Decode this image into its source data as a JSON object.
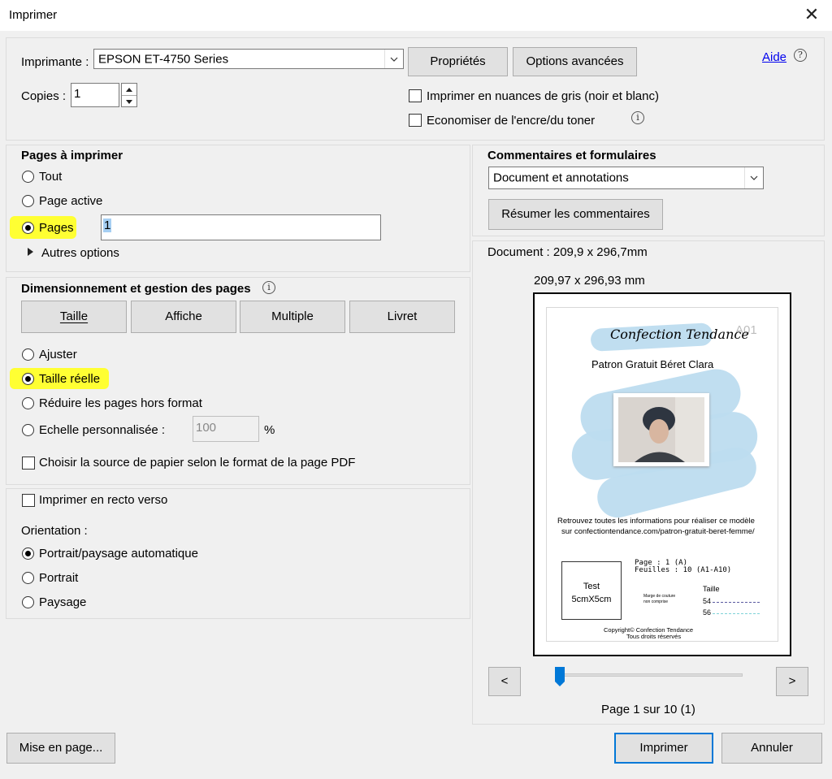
{
  "window": {
    "title": "Imprimer"
  },
  "printer": {
    "label": "Imprimante :",
    "selected": "EPSON ET-4750 Series",
    "properties_button": "Propriétés",
    "advanced_button": "Options avancées",
    "help_link": "Aide",
    "copies_label": "Copies :",
    "copies_value": "1",
    "grayscale_label": "Imprimer en nuances de gris (noir et blanc)",
    "grayscale_checked": false,
    "save_ink_label": "Economiser de l'encre/du toner",
    "save_ink_checked": false
  },
  "pages": {
    "title": "Pages à imprimer",
    "all": "Tout",
    "current": "Page active",
    "pages": "Pages",
    "pages_value": "1",
    "more_options": "Autres options",
    "selected": "pages"
  },
  "comments": {
    "title": "Commentaires et formulaires",
    "selected": "Document et annotations",
    "summarize_button": "Résumer les commentaires"
  },
  "sizing": {
    "title": "Dimensionnement et gestion des pages",
    "tabs": [
      "Taille",
      "Affiche",
      "Multiple",
      "Livret"
    ],
    "fit": "Ajuster",
    "actual": "Taille réelle",
    "shrink": "Réduire les pages hors format",
    "custom": "Echelle personnalisée :",
    "custom_value": "100",
    "percent": "%",
    "paper_source": "Choisir la source de papier selon le format de la page PDF",
    "selected": "actual"
  },
  "duplex": {
    "label": "Imprimer en recto verso",
    "orientation_label": "Orientation :",
    "auto": "Portrait/paysage automatique",
    "portrait": "Portrait",
    "landscape": "Paysage",
    "selected": "auto"
  },
  "preview": {
    "document_size": "Document : 209,9 x 296,7mm",
    "paper_size": "209,97 x 296,93 mm",
    "page_info": "Page 1 sur 10 (1)",
    "prev": "<",
    "next": ">",
    "slider_position": 0.0,
    "page": {
      "corner_label": "A01",
      "brand": "Confection Tendance",
      "subtitle": "Patron Gratuit Béret Clara",
      "info_line1": "Retrouvez toutes les informations pour réaliser ce modèle",
      "info_line2": "sur confectiontendance.com/patron-gratuit-beret-femme/",
      "page_label": "Page : 1 (A)",
      "sheets_label": "Feuilles : 10 (A1-A10)",
      "test_label_1": "Test",
      "test_label_2": "5cmX5cm",
      "seam_note_1": "Marge de couture",
      "seam_note_2": "non comprise",
      "size_title": "Taille",
      "size_1": "54",
      "size_2": "56",
      "copyright_1": "Copyright© Confection Tendance",
      "copyright_2": "Tous droits réservés"
    }
  },
  "footer": {
    "page_setup": "Mise en page...",
    "print": "Imprimer",
    "cancel": "Annuler"
  }
}
